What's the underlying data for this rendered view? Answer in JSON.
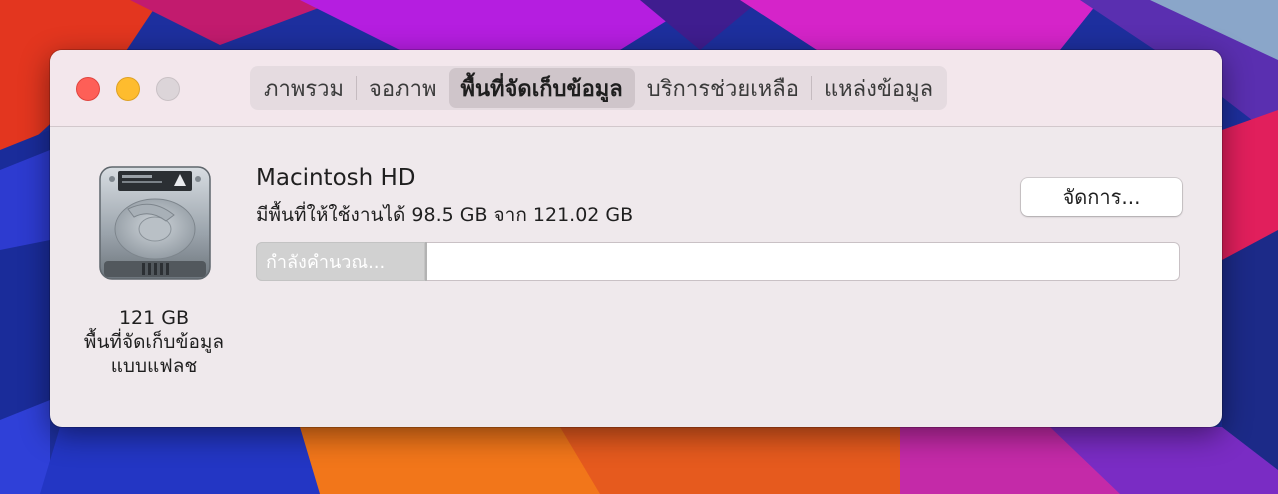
{
  "window": {
    "tabs": [
      {
        "label": "ภาพรวม",
        "active": false
      },
      {
        "label": "จอภาพ",
        "active": false
      },
      {
        "label": "พื้นที่จัดเก็บข้อมูล",
        "active": true
      },
      {
        "label": "บริการช่วยเหลือ",
        "active": false
      },
      {
        "label": "แหล่งข้อมูล",
        "active": false
      }
    ]
  },
  "disk": {
    "icon": "hard-drive-icon",
    "capacity": "121 GB",
    "type_line1": "พื้นที่จัดเก็บข้อมูล",
    "type_line2": "แบบแฟลช"
  },
  "volume": {
    "name": "Macintosh HD",
    "available": "มีพื้นที่ให้ใช้งานได้ 98.5 GB จาก 121.02 GB",
    "manage_label": "จัดการ...",
    "usage_segment_label": "กำลังคำนวณ...",
    "usage_segment_fraction": 0.185
  },
  "colors": {
    "close": "#fe5f57",
    "minimize": "#febc2e",
    "zoom_disabled": "#dcd5d9",
    "window_bg": "#efe9ec",
    "calculating_segment": "#d1d1d1"
  }
}
